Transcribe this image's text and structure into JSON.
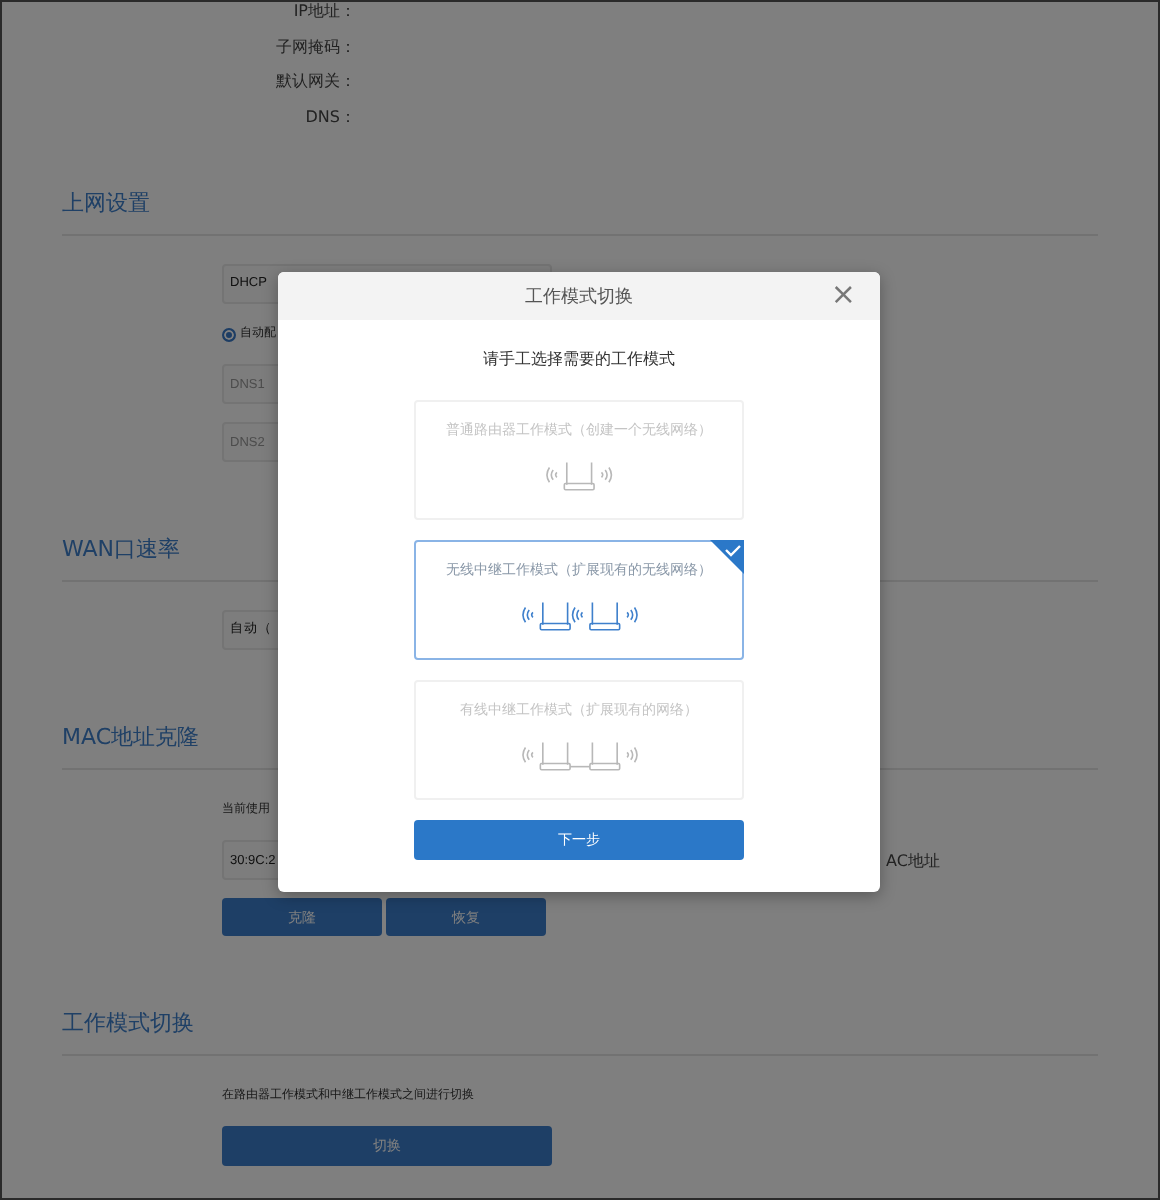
{
  "info_rows": [
    {
      "label": "IP地址："
    },
    {
      "label": "子网掩码："
    },
    {
      "label": "默认网关："
    },
    {
      "label": "DNS："
    }
  ],
  "sections": [
    {
      "title": "上网设置",
      "items": [
        {
          "kind": "select",
          "value": "DHCP"
        },
        {
          "kind": "radio",
          "label": "自动配",
          "selected": true
        },
        {
          "kind": "field",
          "placeholder": "DNS1"
        },
        {
          "kind": "field",
          "placeholder": "DNS2"
        }
      ]
    },
    {
      "title": "WAN口速率",
      "items": [
        {
          "kind": "select",
          "value": "自动（"
        }
      ]
    },
    {
      "title": "MAC地址克隆",
      "items": [
        {
          "kind": "text",
          "text": "当前使用"
        },
        {
          "kind": "field",
          "value": "30:9C:2",
          "note": "AC地址"
        },
        {
          "kind": "buttons",
          "buttons": [
            "克隆",
            "恢复"
          ]
        }
      ]
    },
    {
      "title": "工作模式切换",
      "items": [
        {
          "kind": "text",
          "text": "在路由器工作模式和中继工作模式之间进行切换"
        },
        {
          "kind": "button",
          "label": "切换"
        }
      ]
    }
  ],
  "dialog": {
    "title": "工作模式切换",
    "close": "×",
    "subtitle": "请手工选择需要的工作模式",
    "modes": [
      {
        "label": "普通路由器工作模式（创建一个无线网络）",
        "kind": "router",
        "selected": false
      },
      {
        "label": "无线中继工作模式（扩展现有的无线网络）",
        "kind": "wireless_repeater",
        "selected": true
      },
      {
        "label": "有线中继工作模式（扩展现有的网络）",
        "kind": "wired_repeater",
        "selected": false
      }
    ],
    "button": "下一步"
  }
}
